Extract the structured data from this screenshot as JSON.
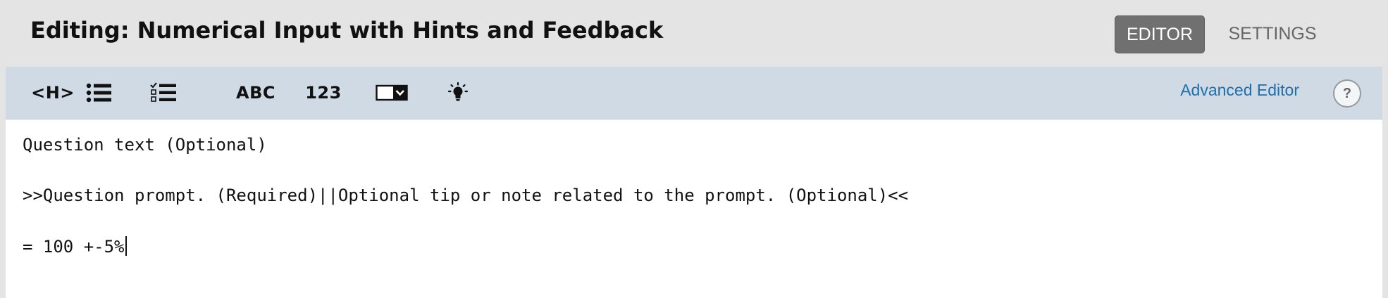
{
  "header": {
    "title": "Editing: Numerical Input with Hints and Feedback",
    "tabs": [
      {
        "label": "EDITOR",
        "active": true
      },
      {
        "label": "SETTINGS",
        "active": false
      }
    ]
  },
  "toolbar": {
    "tools": [
      {
        "name": "heading",
        "label": "<H>",
        "icon": "heading-icon"
      },
      {
        "name": "bullet-list",
        "icon": "bullet-list-icon"
      },
      {
        "name": "checkbox-list",
        "icon": "checklist-icon"
      },
      {
        "name": "text-input",
        "label": "ABC",
        "icon": "text-input-icon"
      },
      {
        "name": "numerical-input",
        "label": "123",
        "icon": "numerical-input-icon"
      },
      {
        "name": "dropdown",
        "icon": "dropdown-icon"
      },
      {
        "name": "hint",
        "icon": "lightbulb-icon"
      }
    ],
    "advanced_editor": "Advanced Editor",
    "help": "?"
  },
  "content": {
    "lines": [
      "Question text (Optional)",
      ">>Question prompt. (Required)||Optional tip or note related to the prompt. (Optional)<<",
      "= 100 +-5%"
    ]
  },
  "colors": {
    "toolbar_bg": "#cfdae4",
    "active_tab_bg": "#707070",
    "link": "#1f6fa8"
  }
}
